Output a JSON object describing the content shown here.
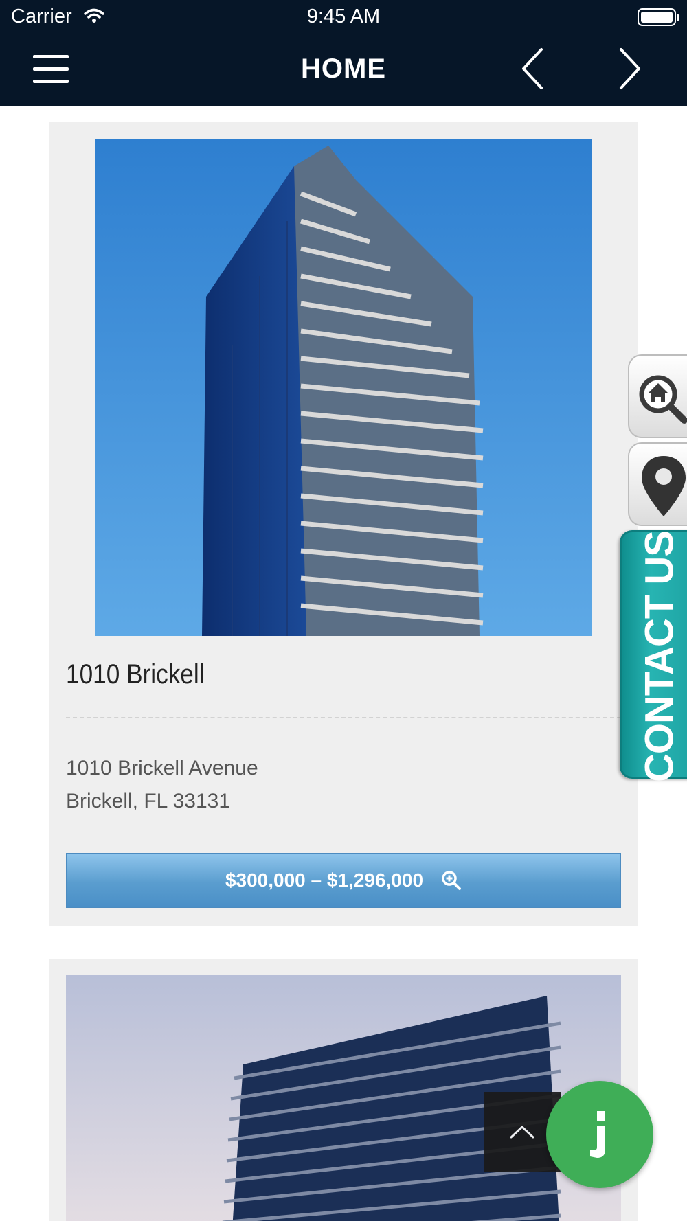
{
  "status_bar": {
    "carrier": "Carrier",
    "time": "9:45 AM"
  },
  "nav": {
    "title": "HOME"
  },
  "listings": [
    {
      "name": "1010 Brickell",
      "address_line1": "1010 Brickell Avenue",
      "address_line2": "Brickell, FL 33131",
      "price_range": "$300,000 – $1,296,000"
    }
  ],
  "side_tabs": {
    "contact_label": "CONTACT US"
  },
  "colors": {
    "nav_bg": "#061628",
    "price_button": "#5a9dcf",
    "contact_tab": "#1ea3a3",
    "chat_fab": "#3fae57"
  },
  "icons": [
    "wifi-icon",
    "battery-icon",
    "hamburger-menu-icon",
    "chevron-left-icon",
    "chevron-right-icon",
    "zoom-in-icon",
    "home-search-icon",
    "map-pin-icon",
    "chevron-up-icon",
    "chat-icon"
  ]
}
